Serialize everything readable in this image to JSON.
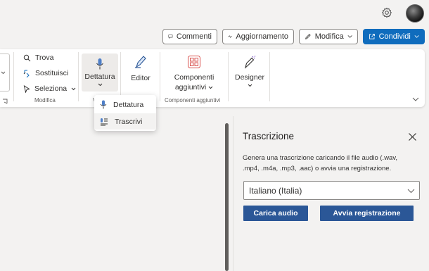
{
  "header": {
    "settings_icon": "gear-icon",
    "avatar_icon": "user-avatar"
  },
  "toolbar": {
    "commenti": "Commenti",
    "aggiornamento": "Aggiornamento",
    "modifica": "Modifica",
    "condividi": "Condividi",
    "accent": "#0f6cbd"
  },
  "ribbon": {
    "modifica_group": {
      "trova": "Trova",
      "sostituisci": "Sostituisci",
      "seleziona": "Seleziona",
      "label": "Modifica"
    },
    "dettatura": "Dettatura",
    "editor": "Editor",
    "componenti_line1": "Componenti",
    "componenti_line2": "aggiuntivi",
    "componenti_group": "Componenti aggiuntivi",
    "designer": "Designer",
    "voice_group_partial": "V"
  },
  "dropdown": {
    "items": [
      "Dettatura",
      "Trascrivi"
    ]
  },
  "panel": {
    "title": "Trascrizione",
    "description": "Genera una trascrizione caricando il file audio (.wav, .mp4, .m4a, .mp3, .aac) o avvia una registrazione.",
    "language_selected": "Italiano (Italia)",
    "upload_button": "Carica audio",
    "record_button": "Avvia registrazione",
    "button_color": "#2b5797"
  }
}
